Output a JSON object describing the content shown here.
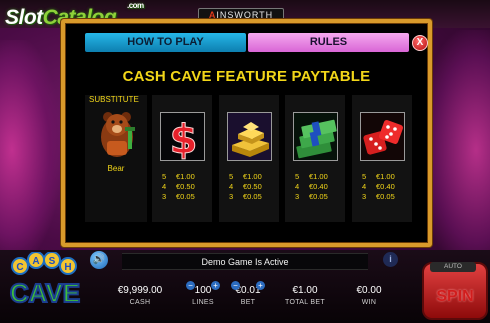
{
  "brand": {
    "name_part1": "Slot",
    "name_part2": "Catalog",
    "suffix": ".com"
  },
  "provider": {
    "name": "INSWORTH",
    "mark": "A"
  },
  "tabs": {
    "how_to_play": "HOW TO PLAY",
    "rules": "RULES",
    "active": "rules"
  },
  "close_symbol": "X",
  "paytable": {
    "title": "CASH CAVE FEATURE PAYTABLE",
    "substitute": {
      "label": "SUBSTITUTE",
      "name": "Bear",
      "icon": "bear-icon"
    },
    "symbols": [
      {
        "icon": "dollar-sign-icon",
        "pays": [
          {
            "count": "5",
            "value": "€1.00"
          },
          {
            "count": "4",
            "value": "€0.50"
          },
          {
            "count": "3",
            "value": "€0.05"
          }
        ]
      },
      {
        "icon": "gold-bars-icon",
        "pays": [
          {
            "count": "5",
            "value": "€1.00"
          },
          {
            "count": "4",
            "value": "€0.50"
          },
          {
            "count": "3",
            "value": "€0.05"
          }
        ]
      },
      {
        "icon": "cash-stack-icon",
        "pays": [
          {
            "count": "5",
            "value": "€1.00"
          },
          {
            "count": "4",
            "value": "€0.40"
          },
          {
            "count": "3",
            "value": "€0.05"
          }
        ]
      },
      {
        "icon": "dice-icon",
        "pays": [
          {
            "count": "5",
            "value": "€1.00"
          },
          {
            "count": "4",
            "value": "€0.40"
          },
          {
            "count": "3",
            "value": "€0.05"
          }
        ]
      }
    ]
  },
  "game_logo": {
    "word1_letters": [
      "C",
      "A",
      "S",
      "H"
    ],
    "word2": "CAVE"
  },
  "message": "Demo Game Is Active",
  "info_symbol": "i",
  "stats": {
    "cash": {
      "value": "€9,999.00",
      "label": "CASH"
    },
    "lines": {
      "value": "100",
      "label": "LINES"
    },
    "bet": {
      "value": "€0.01",
      "label": "BET"
    },
    "total_bet": {
      "value": "€1.00",
      "label": "TOTAL BET"
    },
    "win": {
      "value": "€0.00",
      "label": "WIN"
    }
  },
  "controls": {
    "minus": "−",
    "plus": "+",
    "auto": "AUTO",
    "spin": "SPIN"
  },
  "colors": {
    "gold_text": "#f2d619",
    "frame": "#d99a2b",
    "tab_blue": "#0d7fb0",
    "tab_pink": "#d966d6"
  }
}
